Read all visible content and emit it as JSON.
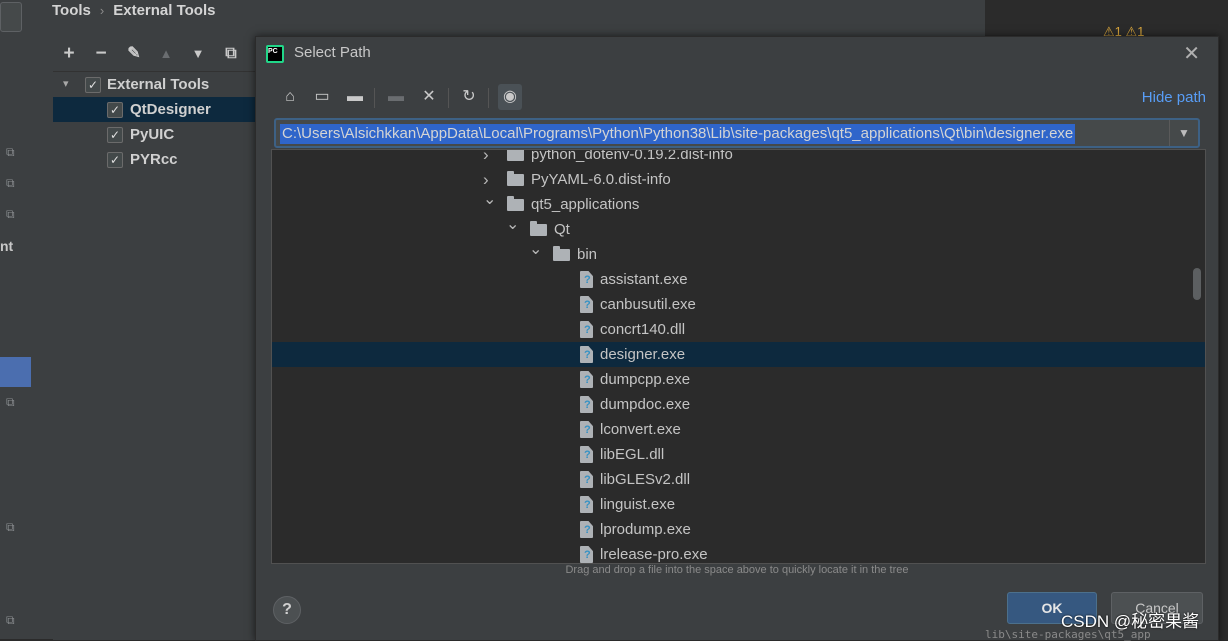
{
  "breadcrumb": {
    "root": "Tools",
    "separator": "›",
    "current": "External Tools"
  },
  "left_strip": {
    "partial_label": "nt"
  },
  "external_tools": {
    "group_label": "External Tools",
    "items": [
      {
        "label": "QtDesigner",
        "checked": true,
        "selected": true
      },
      {
        "label": "PyUIC",
        "checked": true,
        "selected": false
      },
      {
        "label": "PYRcc",
        "checked": true,
        "selected": false
      }
    ]
  },
  "editor": {
    "warnings": "⚠1 ⚠1"
  },
  "dialog": {
    "logo_text": "PC",
    "title": "Select Path",
    "hide_path": "Hide path",
    "path_value": "C:\\Users\\Alsichkkan\\AppData\\Local\\Programs\\Python\\Python38\\Lib\\site-packages\\qt5_applications\\Qt\\bin\\designer.exe",
    "hint": "Drag and drop a file into the space above to quickly locate it in the tree",
    "ok": "OK",
    "cancel": "Cancel",
    "help": "?"
  },
  "tree": [
    {
      "name": "python_dotenv-0.19.2.dist-info",
      "type": "folder",
      "level": 0,
      "expanded": false
    },
    {
      "name": "PyYAML-6.0.dist-info",
      "type": "folder",
      "level": 0,
      "expanded": false
    },
    {
      "name": "qt5_applications",
      "type": "folder",
      "level": 0,
      "expanded": true
    },
    {
      "name": "Qt",
      "type": "folder",
      "level": 1,
      "expanded": true
    },
    {
      "name": "bin",
      "type": "folder",
      "level": 2,
      "expanded": true
    },
    {
      "name": "assistant.exe",
      "type": "file",
      "level": 3
    },
    {
      "name": "canbusutil.exe",
      "type": "file",
      "level": 3
    },
    {
      "name": "concrt140.dll",
      "type": "file",
      "level": 3
    },
    {
      "name": "designer.exe",
      "type": "file",
      "level": 3,
      "selected": true
    },
    {
      "name": "dumpcpp.exe",
      "type": "file",
      "level": 3
    },
    {
      "name": "dumpdoc.exe",
      "type": "file",
      "level": 3
    },
    {
      "name": "lconvert.exe",
      "type": "file",
      "level": 3
    },
    {
      "name": "libEGL.dll",
      "type": "file",
      "level": 3
    },
    {
      "name": "libGLESv2.dll",
      "type": "file",
      "level": 3
    },
    {
      "name": "linguist.exe",
      "type": "file",
      "level": 3
    },
    {
      "name": "lprodump.exe",
      "type": "file",
      "level": 3
    },
    {
      "name": "lrelease-pro.exe",
      "type": "file",
      "level": 3
    }
  ],
  "watermark": "CSDN @秘密果酱",
  "bottom_code": "lib\\site-packages\\qt5_app"
}
